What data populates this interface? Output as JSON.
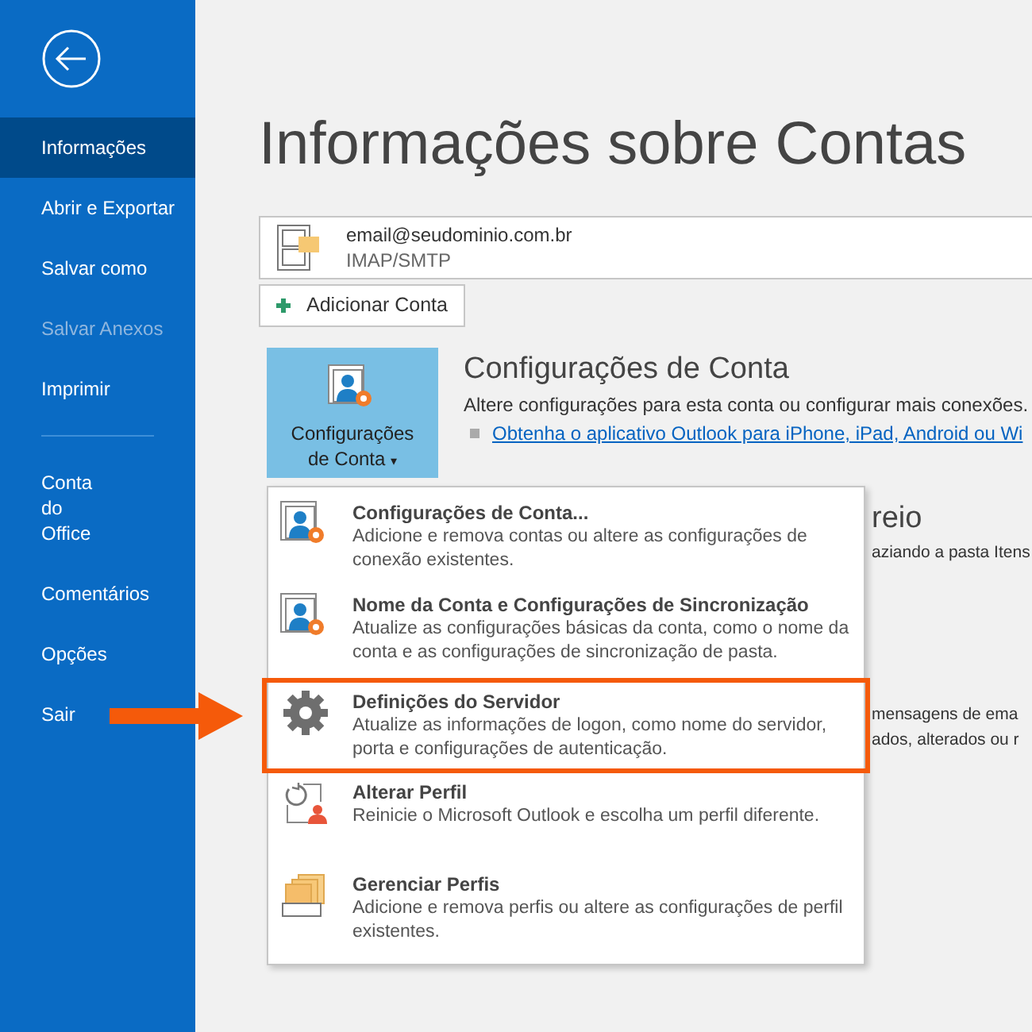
{
  "sidebar": {
    "items": [
      {
        "kind": "item",
        "label": "Informações",
        "selected": true,
        "disabled": false
      },
      {
        "kind": "item",
        "label": "Abrir e Exportar",
        "selected": false,
        "disabled": false
      },
      {
        "kind": "item",
        "label": "Salvar como",
        "selected": false,
        "disabled": false
      },
      {
        "kind": "item",
        "label": "Salvar Anexos",
        "selected": false,
        "disabled": true
      },
      {
        "kind": "item",
        "label": "Imprimir",
        "selected": false,
        "disabled": false
      },
      {
        "kind": "divider"
      },
      {
        "kind": "item",
        "label": "Conta\ndo\nOffice",
        "selected": false,
        "disabled": false
      },
      {
        "kind": "item",
        "label": "Comentários",
        "selected": false,
        "disabled": false
      },
      {
        "kind": "item",
        "label": "Opções",
        "selected": false,
        "disabled": false
      },
      {
        "kind": "item",
        "label": "Sair",
        "selected": false,
        "disabled": false
      }
    ]
  },
  "page_title": "Informações sobre Contas",
  "account": {
    "email": "email@seudominio.com.br",
    "type": "IMAP/SMTP"
  },
  "add_account_button": "Adicionar Conta",
  "account_settings": {
    "button": "Configurações\nde Conta",
    "caret": "▾",
    "title": "Configurações de Conta",
    "description": "Altere configurações para esta conta ou configurar mais conexões.",
    "link": "Obtenha o aplicativo Outlook para iPhone, iPad, Android ou Wi"
  },
  "hidden_fragments": {
    "heading": "reio",
    "line_1": "aziando a pasta Itens",
    "line_2": "mensagens de ema",
    "line_3": "ados, alterados ou r"
  },
  "dropdown": {
    "items": [
      {
        "kind": "account",
        "title": "Configurações de Conta...",
        "description": "Adicione e remova contas ou altere as configurações de conexão existentes.",
        "selected": false
      },
      {
        "kind": "account",
        "title": "Nome da Conta e Configurações de Sincronização",
        "description": "Atualize as configurações básicas da conta, como o nome da conta e as configurações de sincronização de pasta.",
        "selected": false
      },
      {
        "kind": "gear",
        "title": "Definições do Servidor",
        "description": "Atualize as informações de logon, como nome do servidor, porta e configurações de autenticação.",
        "selected": true
      },
      {
        "kind": "profile",
        "title": "Alterar Perfil",
        "description": "Reinicie o Microsoft Outlook e escolha um perfil diferente.",
        "selected": false
      },
      {
        "kind": "profiles",
        "title": "Gerenciar Perfis",
        "description": "Adicione e remova perfis ou altere as configurações de perfil existentes.",
        "selected": false
      }
    ]
  }
}
